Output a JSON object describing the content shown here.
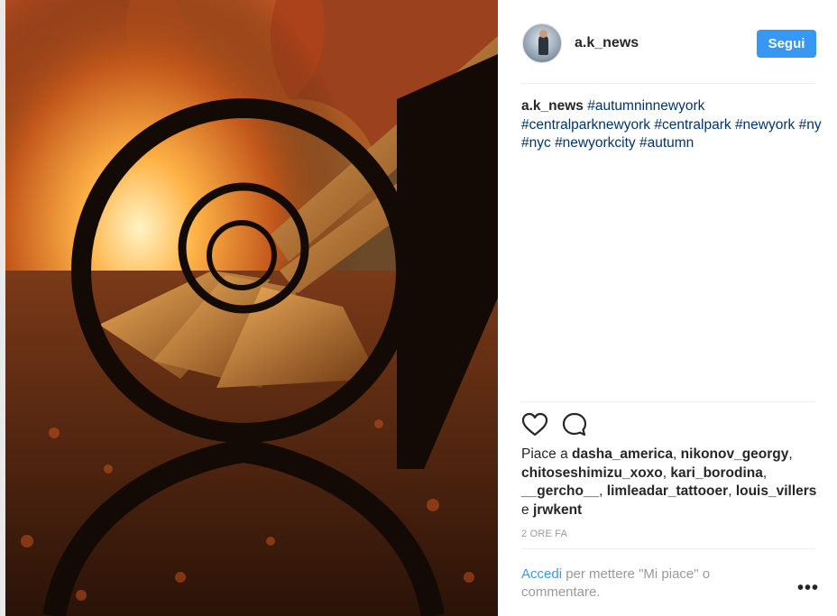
{
  "post": {
    "author": "a.k_news",
    "follow_label": "Segui",
    "caption": {
      "user": "a.k_news",
      "hashtags": [
        "#autumninnewyork",
        "#centralparknewyork",
        "#centralpark",
        "#newyork",
        "#ny",
        "#nyc",
        "#newyorkcity",
        "#autumn"
      ]
    },
    "likes": {
      "prefix": "Piace a",
      "users": [
        "dasha_america",
        "nikonov_georgy",
        "chitoseshimizu_xoxo",
        "kari_borodina",
        "__gercho__",
        "limleadar_tattooer",
        "louis_villers"
      ],
      "conjunction": "e",
      "last_user": "jrwkent"
    },
    "timestamp": "2 ORE FA",
    "login_prompt": {
      "link": "Accedi",
      "text": "per mettere \"Mi piace\" o commentare."
    },
    "more_label": "•••"
  },
  "icons": {
    "like": "heart-outline-icon",
    "comment": "speech-bubble-icon",
    "more": "ellipsis-icon"
  },
  "colors": {
    "accent": "#3897f0",
    "hashtag": "#003569",
    "muted": "#999999",
    "text": "#262626"
  }
}
